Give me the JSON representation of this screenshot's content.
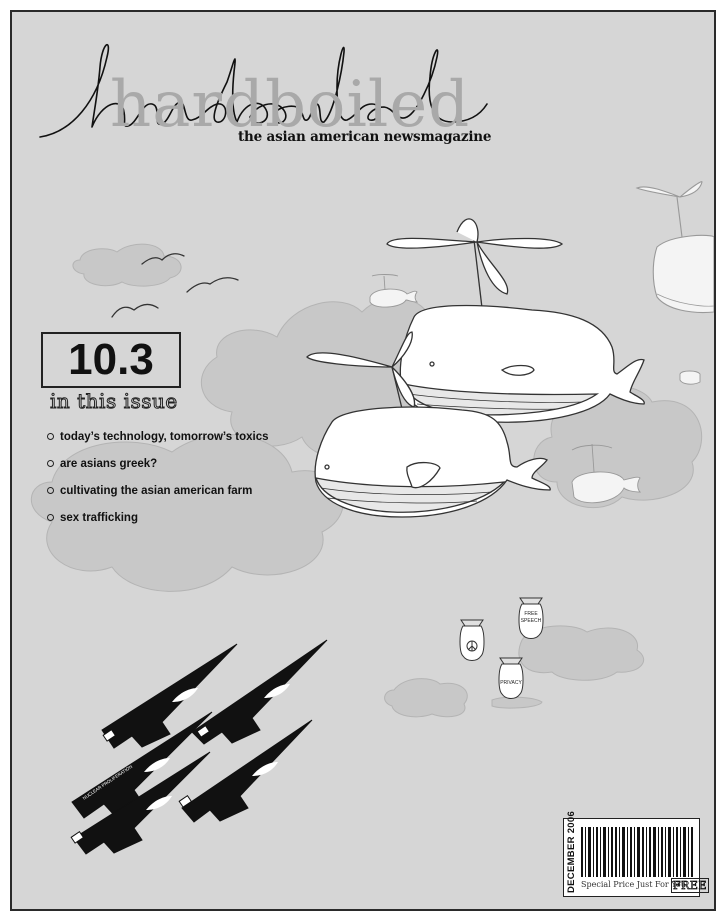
{
  "masthead": {
    "title_ghost": "hardboiled",
    "tagline": "the asian american newsmagazine"
  },
  "issue": {
    "number": "10.3",
    "label": "in this issue"
  },
  "contents": [
    "today’s technology, tomorrow’s toxics",
    "are asians greek?",
    "cultivating the asian american farm",
    "sex trafficking"
  ],
  "bombs": {
    "free_speech": "FREE SPEECH",
    "privacy": "PRIVACY"
  },
  "jets": {
    "label": "NUCLEAR PROLIFERATION"
  },
  "barcode": {
    "date": "DECEMBER 2006",
    "price_text": "Special Price Just For You",
    "price_value": "FREE"
  },
  "colors": {
    "background": "#d6d6d6",
    "ink": "#111111",
    "cloud": "#c8c8c8"
  }
}
